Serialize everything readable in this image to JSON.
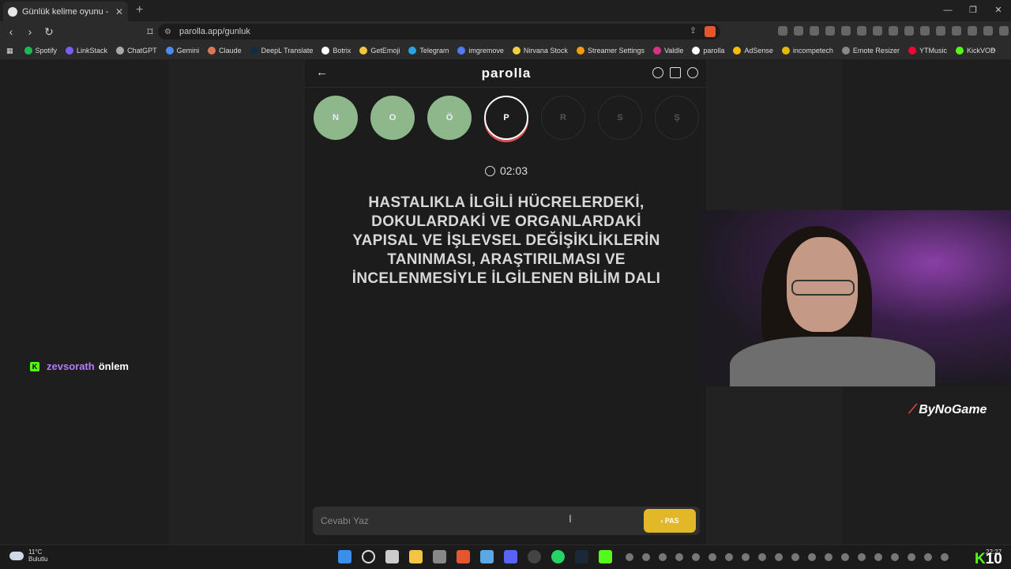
{
  "browser": {
    "tab_title": "Günlük kelime oyunu - parolla",
    "url": "parolla.app/gunluk",
    "bookmarks": [
      "Spotify",
      "LinkStack",
      "ChatGPT",
      "Gemini",
      "Claude",
      "DeepL Translate",
      "Botrix",
      "GetEmoji",
      "Telegram",
      "imgremove",
      "Nirvana Stock",
      "Streamer Settings",
      "Valdle",
      "parolla",
      "AdSense",
      "incompetech",
      "Emote Resizer",
      "YTMusic",
      "KickVOD"
    ],
    "bookmark_colors": [
      "#1db954",
      "#7b5cff",
      "#aaaaaa",
      "#4b8bf5",
      "#d97757",
      "#0f2b46",
      "#ffffff",
      "#f4c542",
      "#2aa3e0",
      "#4f7cff",
      "#f4d03f",
      "#f39c12",
      "#d63384",
      "#ffffff",
      "#fbbc04",
      "#e6b800",
      "#888888",
      "#ff0033",
      "#53fc18"
    ]
  },
  "app": {
    "logo": "parolla",
    "letters": [
      {
        "char": "N",
        "state": "done"
      },
      {
        "char": "O",
        "state": "done"
      },
      {
        "char": "Ö",
        "state": "done"
      },
      {
        "char": "P",
        "state": "active"
      },
      {
        "char": "R",
        "state": "pending"
      },
      {
        "char": "S",
        "state": "pending"
      },
      {
        "char": "Ş",
        "state": "pending"
      }
    ],
    "timer": "02:03",
    "question": "HASTALIKLA İLGİLİ HÜCRELERDEKİ, DOKULARDAKİ VE ORGANLARDAKİ YAPISAL VE İŞLEVSEL DEĞİŞİKLİKLERİN TANINMASI, ARAŞTIRILMASI VE İNCELENMESİYLE İLGİLENEN BİLİM DALI",
    "answer_placeholder": "Cevabı Yaz",
    "pass_label": "PAS"
  },
  "chat": {
    "platform_icon": "K",
    "username": "zevsorath",
    "message": "önlem"
  },
  "overlay": {
    "brand": "ByNoGame",
    "kick_label": "K",
    "kick_count": "10"
  },
  "taskbar": {
    "temperature": "11°C",
    "condition": "Bulutlu",
    "time": "22:27"
  }
}
